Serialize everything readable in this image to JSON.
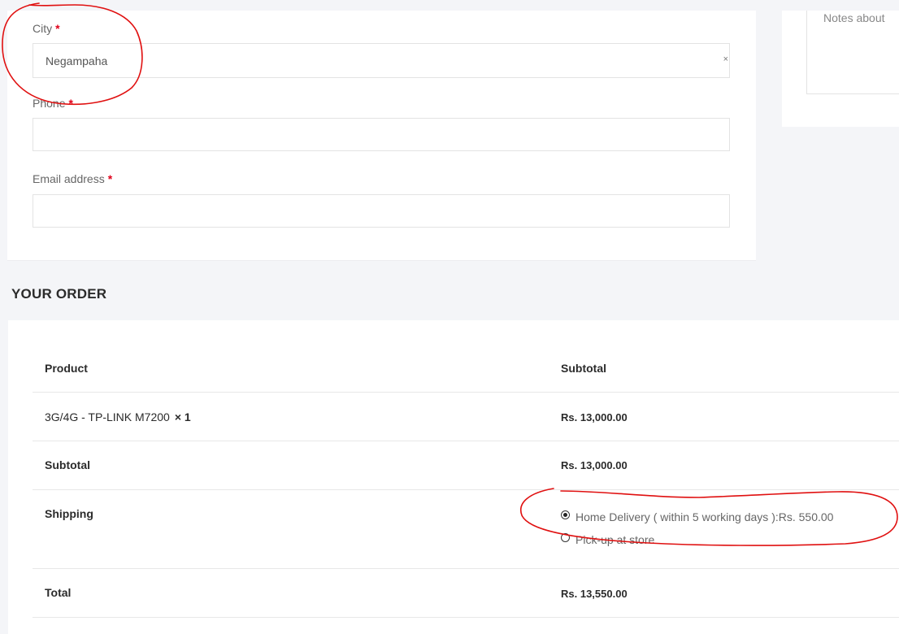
{
  "billing": {
    "city": {
      "label": "City",
      "required_mark": "*",
      "value": "Negampaha",
      "clear_glyph": "×"
    },
    "phone": {
      "label": "Phone",
      "required_mark": "*",
      "value": ""
    },
    "email": {
      "label": "Email address",
      "required_mark": "*",
      "value": ""
    }
  },
  "notes": {
    "placeholder": "Notes about"
  },
  "order": {
    "heading": "YOUR ORDER",
    "headers": {
      "product": "Product",
      "subtotal": "Subtotal"
    },
    "items": [
      {
        "name": "3G/4G - TP-LINK M7200",
        "qty": "× 1",
        "subtotal": "Rs. 13,000.00"
      }
    ],
    "subtotal_row": {
      "label": "Subtotal",
      "value": "Rs. 13,000.00"
    },
    "shipping_row": {
      "label": "Shipping",
      "options": [
        {
          "label": "Home Delivery ( within 5 working days ): ",
          "price": "Rs. 550.00",
          "selected": true
        },
        {
          "label": "Pick-up at store",
          "price": "",
          "selected": false
        }
      ]
    },
    "total_row": {
      "label": "Total",
      "value": "Rs. 13,550.00"
    }
  },
  "colors": {
    "background": "#f4f5f8",
    "card": "#ffffff",
    "required": "#e0001a",
    "annotation": "#e01010"
  }
}
